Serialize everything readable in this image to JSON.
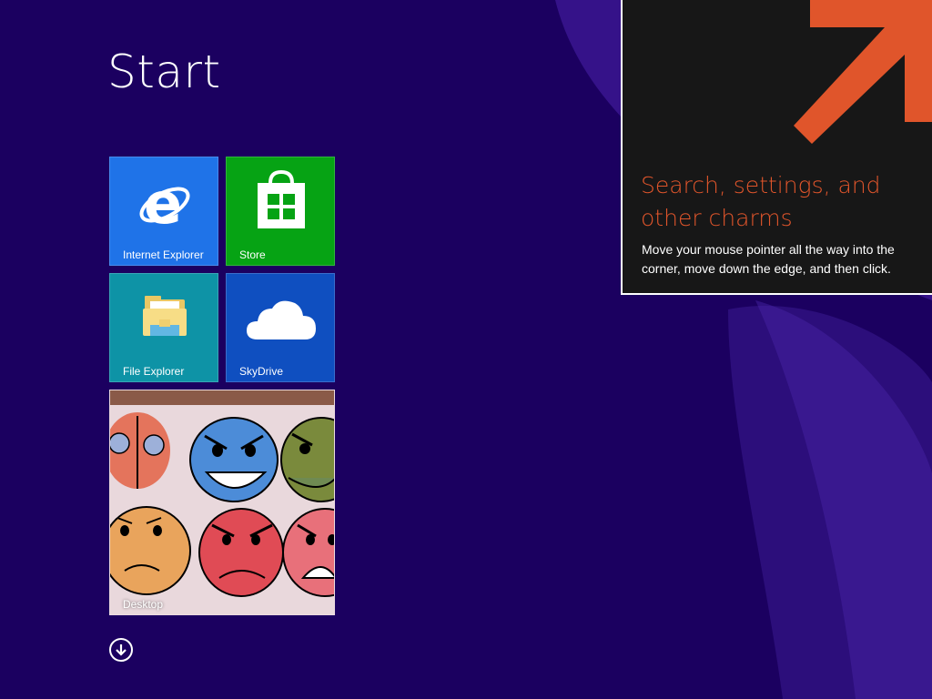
{
  "start": {
    "title": "Start"
  },
  "tiles": [
    {
      "label": "Internet Explorer",
      "icon": "internet-explorer-icon",
      "color": "#1f73e8"
    },
    {
      "label": "Store",
      "icon": "store-bag-icon",
      "color": "#06a314"
    },
    {
      "label": "File Explorer",
      "icon": "folder-icon",
      "color": "#0e93a6"
    },
    {
      "label": "SkyDrive",
      "icon": "cloud-icon",
      "color": "#0f4fc0"
    },
    {
      "label": "Desktop",
      "icon": "desktop-wallpaper-image",
      "color": "#e7d2d8"
    }
  ],
  "apps_button": {
    "icon": "arrow-down-circle-icon"
  },
  "tip": {
    "heading_line1": "Search, settings, and",
    "heading_line2": "other charms",
    "body_line1": "Move your mouse pointer all the way into the",
    "body_line2": "corner, move down the edge, and then click.",
    "accent_color": "#e0552b",
    "arrow_icon": "arrow-up-right-icon"
  },
  "theme": {
    "background": "#1b0060"
  }
}
